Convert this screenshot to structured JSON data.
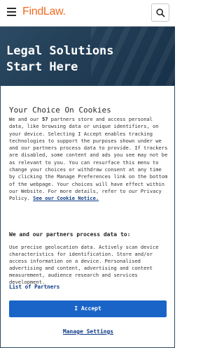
{
  "header": {
    "logo": "FindLaw.",
    "menu_icon": "hamburger-menu-icon",
    "search_icon": "search-icon"
  },
  "hero": {
    "title": "Legal Solutions Start Here"
  },
  "cookie_banner": {
    "title": "Your Choice On Cookies",
    "body_intro": "We and our ",
    "partner_count": "57",
    "body_main": " partners store and access personal data, like browsing data or unique identifiers, on your device. Selecting I Accept enables tracking technologies to support the purposes shown under we and our partners process data to provide. If trackers are disabled, some content and ads you see may not be as relevant to you. You can resurface this menu to change your choices or withdraw consent at any time by clicking the Manage Preferences link on the bottom of the webpage. Your choices will have effect within our Website. For more details, refer to our Privacy Policy. ",
    "cookie_notice_link": "See our Cookie Notice.",
    "purposes_heading": "We and our partners process data to:",
    "purposes_text": "Use precise geolocation data. Actively scan device characteristics for identification. Store and/or access information on a device. Personalised advertising and content, advertising and content measurement, audience research and services development.",
    "partners_link": "List of Partners",
    "accept_label": "I Accept",
    "settings_label": "Manage Settings"
  },
  "colors": {
    "brand": "#f26b21",
    "hero_bg": "#1f3a52",
    "accept_bg": "#1a64c8",
    "link": "#0f3c87"
  }
}
